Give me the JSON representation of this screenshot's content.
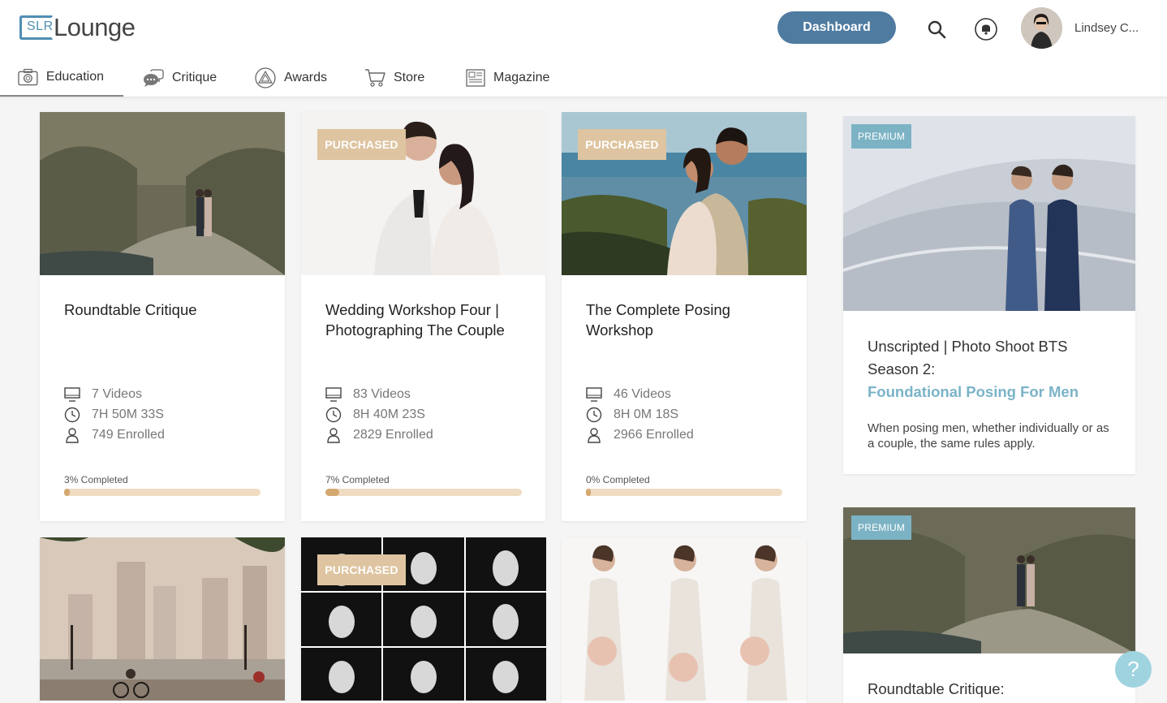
{
  "brand": {
    "logo_slr": "SLR",
    "logo_word": "Lounge"
  },
  "header": {
    "dashboard_label": "Dashboard",
    "user_name": "Lindsey C..."
  },
  "nav": [
    {
      "label": "Education",
      "icon": "camera-icon",
      "active": true
    },
    {
      "label": "Critique",
      "icon": "chat-icon"
    },
    {
      "label": "Awards",
      "icon": "awards-icon"
    },
    {
      "label": "Store",
      "icon": "cart-icon"
    },
    {
      "label": "Magazine",
      "icon": "magazine-icon"
    }
  ],
  "courses": [
    {
      "title": "Roundtable Critique",
      "badge": "",
      "videos": "7 Videos",
      "duration": "7H 50M 33S",
      "enrolled": "749 Enrolled",
      "progress_label": "3% Completed",
      "progress": 3
    },
    {
      "title": "Wedding Workshop Four | Photographing The Couple",
      "badge": "PURCHASED",
      "videos": "83 Videos",
      "duration": "8H 40M 23S",
      "enrolled": "2829 Enrolled",
      "progress_label": "7% Completed",
      "progress": 7
    },
    {
      "title": "The Complete Posing Workshop",
      "badge": "PURCHASED",
      "videos": "46 Videos",
      "duration": "8H 0M 18S",
      "enrolled": "2966 Enrolled",
      "progress_label": "0% Completed",
      "progress": 0
    },
    {
      "badge": ""
    },
    {
      "badge": "PURCHASED"
    },
    {
      "badge": ""
    }
  ],
  "side": [
    {
      "badge": "PREMIUM",
      "title": "Unscripted | Photo Shoot BTS Season 2:",
      "subtitle": "Foundational Posing For Men",
      "desc": "When posing men, whether individually or as a couple, the same rules apply."
    },
    {
      "badge": "PREMIUM",
      "title": "Roundtable Critique:"
    }
  ],
  "help": {
    "label": "?"
  },
  "colors": {
    "accent": "#4f7ba1",
    "badge": "#dec4a0",
    "premium": "#7cb3c4",
    "progress": "#d4a871",
    "link": "#7bb3c8"
  }
}
